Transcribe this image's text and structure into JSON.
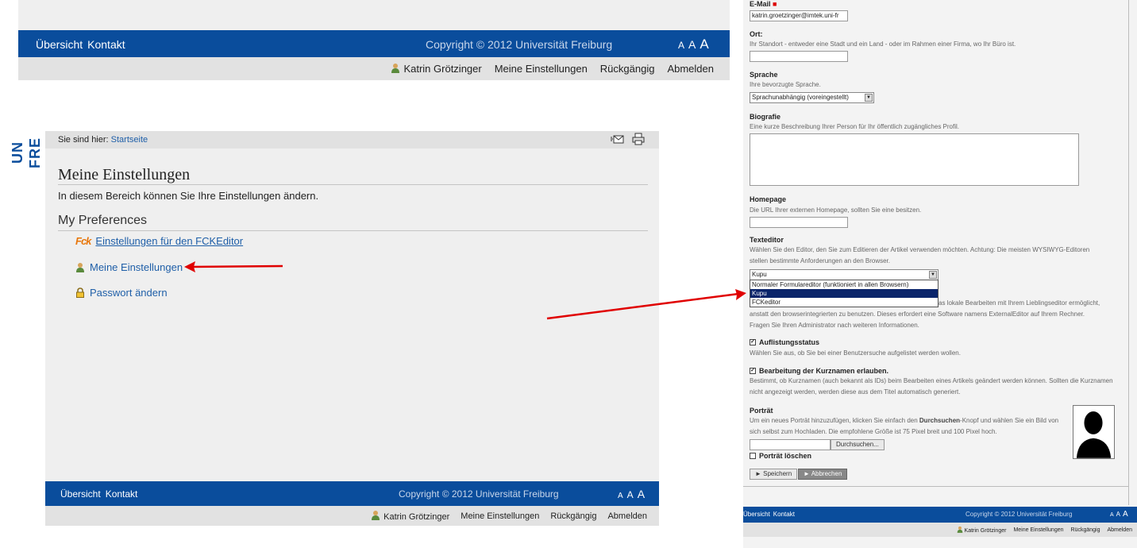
{
  "top": {
    "nav": [
      "Übersicht",
      "Kontakt"
    ],
    "copyright": "Copyright © 2012 Universität Freiburg",
    "font_sizes": [
      "A",
      "A",
      "A"
    ],
    "user": "Katrin Grötzinger",
    "actions": [
      "Meine Einstellungen",
      "Rückgängig",
      "Abmelden"
    ]
  },
  "logo": {
    "line1": "UN",
    "line2": "FRE"
  },
  "page": {
    "breadcrumb_prefix": "Sie sind hier:",
    "breadcrumb_link": "Startseite",
    "title": "Meine Einstellungen",
    "intro": "In diesem Bereich können Sie Ihre Einstellungen ändern.",
    "subtitle": "My Preferences",
    "fck_icon_text": "Fck",
    "prefs": [
      "Einstellungen für den FCKEditor",
      "Meine Einstellungen",
      "Passwort ändern"
    ]
  },
  "footer": {
    "nav": [
      "Übersicht",
      "Kontakt"
    ],
    "copyright": "Copyright © 2012 Universität Freiburg",
    "font_sizes": [
      "A",
      "A",
      "A"
    ],
    "user": "Katrin Grötzinger",
    "actions": [
      "Meine Einstellungen",
      "Rückgängig",
      "Abmelden"
    ]
  },
  "form": {
    "email_label": "E-Mail",
    "email_value": "katrin.groetzinger@imtek.uni-fr",
    "ort_label": "Ort:",
    "ort_help": "Ihr Standort - entweder eine Stadt und ein Land - oder im Rahmen einer Firma, wo Ihr Büro ist.",
    "sprache_label": "Sprache",
    "sprache_help": "Ihre bevorzugte Sprache.",
    "sprache_value": "Sprachunabhängig (voreingestellt)",
    "bio_label": "Biografie",
    "bio_help": "Eine kurze Beschreibung Ihrer Person für Ihr öffentlich zugängliches Profil.",
    "homepage_label": "Homepage",
    "homepage_help": "Die URL Ihrer externen Homepage, sollten Sie eine besitzen.",
    "editor_label": "Texteditor",
    "editor_help": "Wählen Sie den Editor, den Sie zum Editieren der Artikel verwenden möchten. Achtung: Die meisten WYSIWYG-Editoren stellen bestimmte Anforderungen an den Browser.",
    "editor_value": "Kupu",
    "editor_options": [
      "Normaler Formulareditor (funktioniert in allen Browsern)",
      "Kupu",
      "FCKeditor"
    ],
    "ext_help_1": "as lokale Bearbeiten mit Ihrem Lieblingseditor ermöglicht,",
    "ext_help_2": "anstatt den browserintegrierten zu benutzen. Dieses erfordert eine Software namens ExternalEditor auf Ihrem Rechner.",
    "ext_help_3": "Fragen Sie Ihren Administrator nach weiteren Informationen.",
    "listing_label": "Auflistungsstatus",
    "listing_help": "Wählen Sie aus, ob Sie bei einer Benutzersuche aufgelistet werden wollen.",
    "shortname_label": "Bearbeitung der Kurznamen erlauben.",
    "shortname_help": "Bestimmt, ob Kurznamen (auch bekannt als IDs) beim Bearbeiten eines Artikels geändert werden können. Sollten die Kurznamen nicht angezeigt werden, werden diese aus dem Titel automatisch generiert.",
    "portrait_label": "Porträt",
    "portrait_help_a": "Um ein neues Porträt hinzuzufügen, klicken Sie einfach den ",
    "portrait_help_b": "Durchsuchen",
    "portrait_help_c": "-Knopf und wählen Sie ein Bild von sich selbst zum Hochladen. Die empfohlene Größe ist 75 Pixel breit und 100 Pixel hoch.",
    "browse_button": "Durchsuchen...",
    "delete_portrait": "Porträt löschen",
    "save_button": "► Speichern",
    "cancel_button": "► Abbrechen"
  },
  "rfooter": {
    "nav": [
      "Übersicht",
      "Kontakt"
    ],
    "copyright": "Copyright © 2012 Universität Freiburg",
    "font_sizes": [
      "A",
      "A",
      "A"
    ],
    "user": "Katrin Grötzinger",
    "actions": [
      "Meine Einstellungen",
      "Rückgängig",
      "Abmelden"
    ]
  },
  "colors": {
    "brand_blue": "#0a4d9c",
    "arrow_red": "#e00000",
    "link": "#1f5fa8"
  }
}
